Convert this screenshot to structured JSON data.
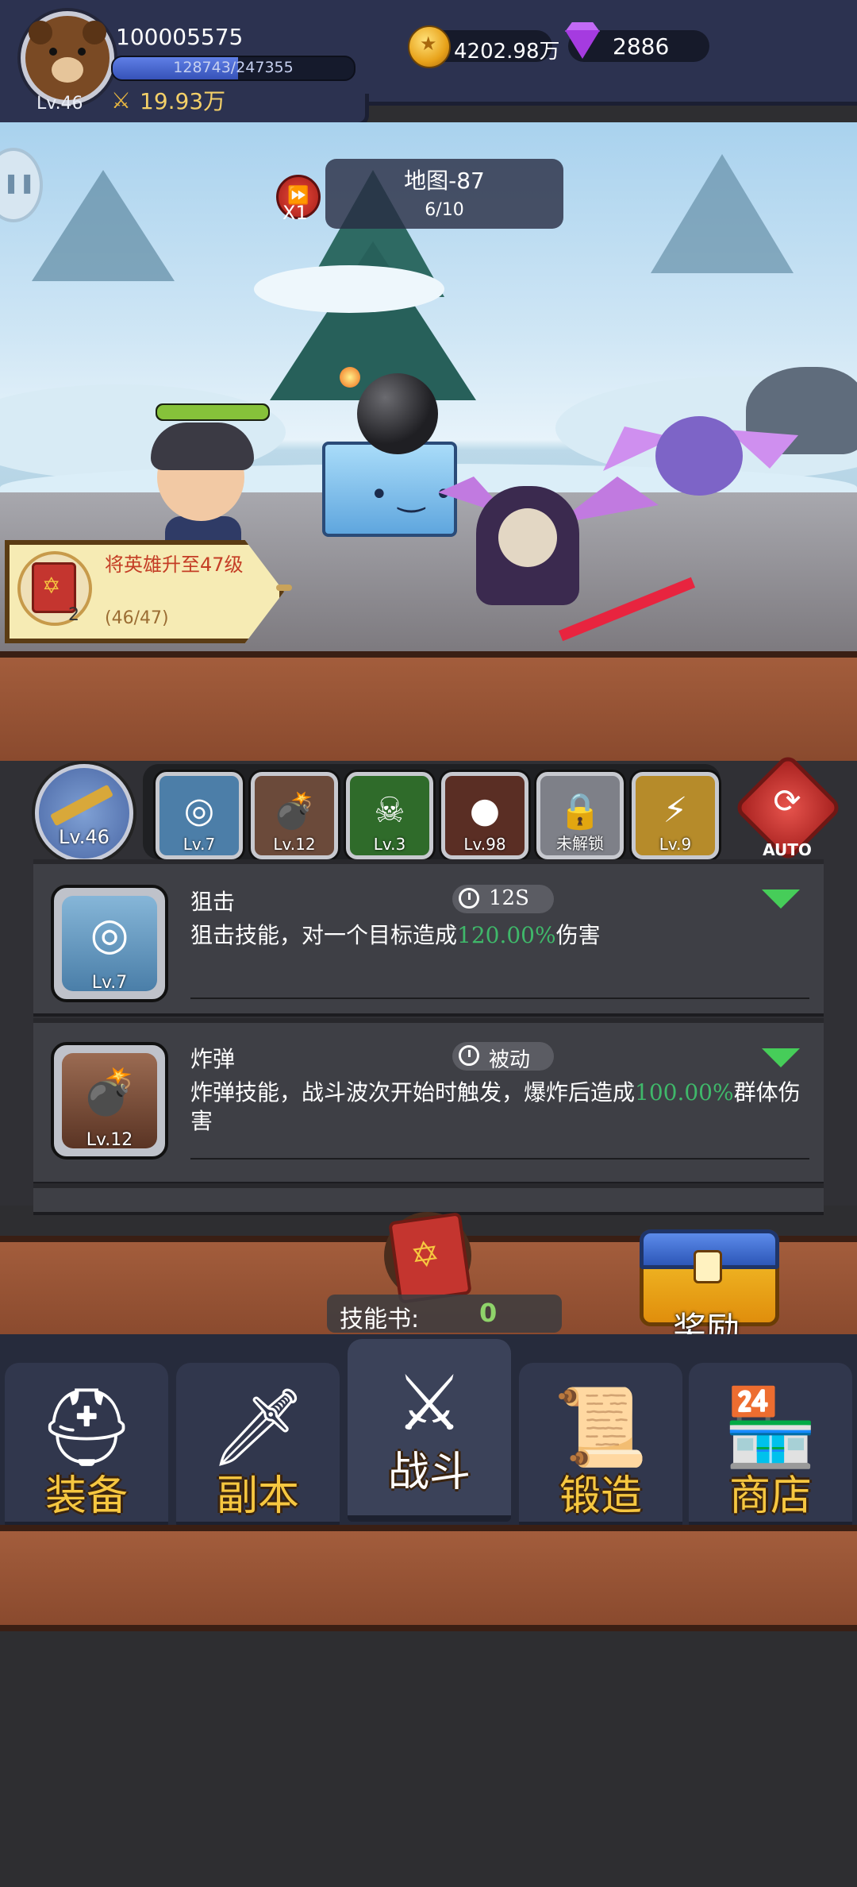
{
  "player": {
    "id": "100005575",
    "level": "Lv.46",
    "exp_text": "128743/247355",
    "exp_fraction": 0.52,
    "power": "19.93万"
  },
  "currency": {
    "gold": "4202.98万",
    "gems": "2886"
  },
  "battle": {
    "map_title": "地图-87",
    "wave_progress": "6/10",
    "speed_label": "X1"
  },
  "quest": {
    "title": "将英雄升至47级",
    "progress": "(46/47)",
    "count": "2"
  },
  "skill_bar": {
    "weapon_level": "Lv.46",
    "slots": [
      {
        "level": "Lv.7",
        "glyph": "◎",
        "color": "#4c7ea8"
      },
      {
        "level": "Lv.12",
        "glyph": "💣",
        "color": "#6b4a3a"
      },
      {
        "level": "Lv.3",
        "glyph": "☠",
        "color": "#2f6b2a"
      },
      {
        "level": "Lv.98",
        "glyph": "●",
        "color": "#5a2e24"
      },
      {
        "level": "未解锁",
        "glyph": "🔒",
        "color": "#7e8088"
      },
      {
        "level": "Lv.9",
        "glyph": "⚡",
        "color": "#b68b2a"
      }
    ],
    "auto_label": "AUTO"
  },
  "skills": [
    {
      "name": "狙击",
      "cooldown": "12S",
      "desc_before": "狙击技能，对一个目标造成",
      "desc_highlight": "120.00%",
      "desc_after": "伤害",
      "level": "Lv.7"
    },
    {
      "name": "炸弹",
      "cooldown": "被动",
      "desc_before": "炸弹技能，战斗波次开始时触发，爆炸后造成",
      "desc_highlight": "100.00%",
      "desc_after": "群体伤害",
      "level": "Lv.12"
    }
  ],
  "skill_books": {
    "label": "技能书:",
    "count": "0"
  },
  "reward_label": "奖励",
  "nav": [
    {
      "label": "装备",
      "icon": "⛑"
    },
    {
      "label": "副本",
      "icon": "🗡"
    },
    {
      "label": "战斗",
      "icon": "⚔"
    },
    {
      "label": "锻造",
      "icon": "📜"
    },
    {
      "label": "商店",
      "icon": "🏪"
    }
  ],
  "colors": {
    "highlight_green": "#3fb86a",
    "nav_label_gold": "#f6c740",
    "quest_red": "#c43d25"
  }
}
